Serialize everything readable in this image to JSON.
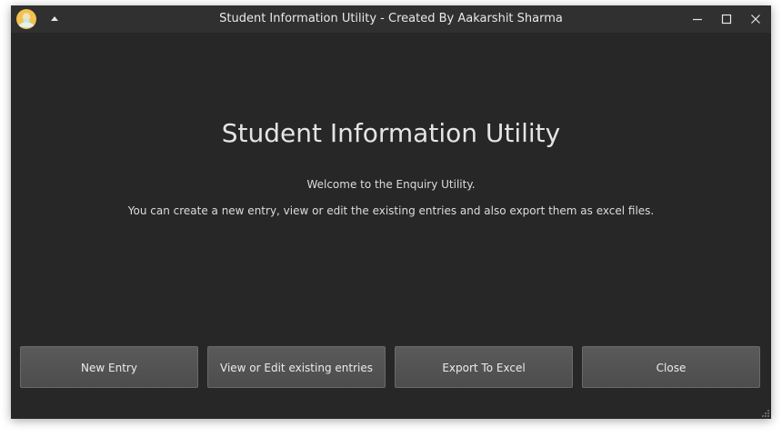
{
  "window": {
    "title": "Student Information Utility - Created By Aakarshit Sharma",
    "icons": {
      "app": "app-icon",
      "menu": "caret-up-icon",
      "minimize": "minimize-icon",
      "maximize": "maximize-icon",
      "close": "close-icon"
    }
  },
  "main": {
    "heading": "Student Information Utility",
    "welcome": "Welcome to the Enquiry Utility.",
    "description": "You can create a new entry, view or edit the existing entries and also export them as excel files."
  },
  "actions": {
    "new_entry": "New Entry",
    "view_edit": "View or Edit existing entries",
    "export": "Export To Excel",
    "close": "Close"
  },
  "colors": {
    "window_bg": "#272727",
    "button_bg": "#555555",
    "text": "#e4e4e4"
  }
}
